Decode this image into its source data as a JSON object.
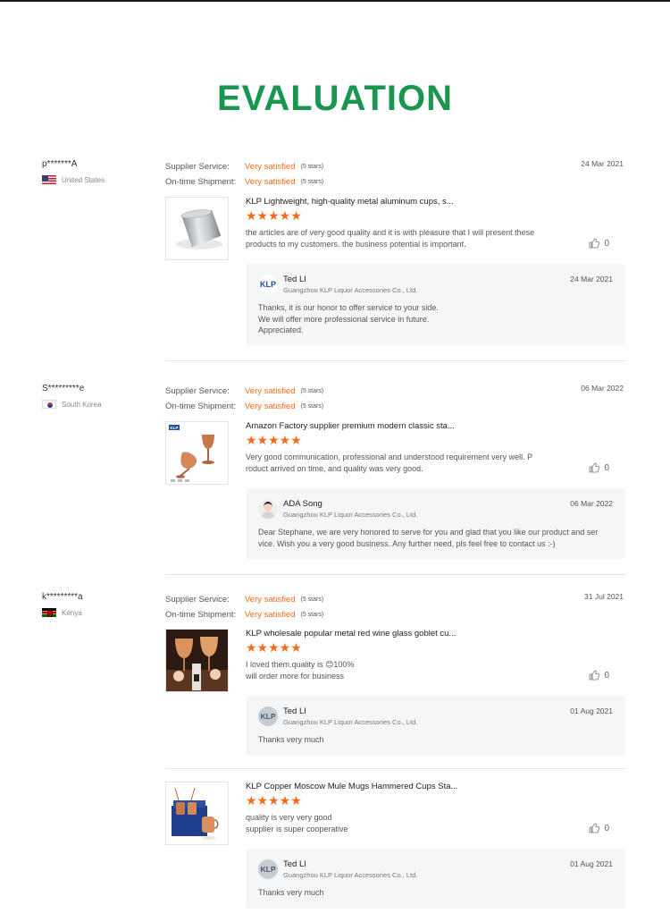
{
  "page": {
    "title": "EVALUATION"
  },
  "labels": {
    "supplier_service": "Supplier Service:",
    "ontime_shipment": "On-time Shipment:"
  },
  "colors": {
    "heading": "#1a9650",
    "accent": "#f26c1f"
  },
  "reviews": [
    {
      "user": "p*******A",
      "country": "United States",
      "flag": "us-flag",
      "supplier_service": "Very satisfied",
      "supplier_stars": "(5 stars)",
      "ontime_shipment": "Very satisfied",
      "ontime_stars": "(5 stars)",
      "date": "24 Mar 2021",
      "product_title": "KLP Lightweight, high-quality metal aluminum cups, s...",
      "product_image": "aluminum-cup-image",
      "rating": 5,
      "text_lines": [
        "the articles are of very good quality and it is with pleasure that I will present these",
        "products to my customers. the business potential is important."
      ],
      "likes": "0",
      "reply": {
        "name": "Ted LI",
        "company": "Guangzhou KLP Liquor Accessories Co., Ltd.",
        "date": "24 Mar 2021",
        "avatar_text": "KLP",
        "lines": [
          "Thanks, it is our honor to offer service to your side.",
          "We will offer more professional service in future.",
          "Appreciated."
        ]
      }
    },
    {
      "user": "S*********e",
      "country": "South Korea",
      "flag": "kr-flag",
      "supplier_service": "Very satisfied",
      "supplier_stars": "(5 stars)",
      "ontime_shipment": "Very satisfied",
      "ontime_stars": "(5 stars)",
      "date": "06 Mar 2022",
      "product_title": "Amazon Factory supplier premium modern classic sta...",
      "product_image": "copper-goblet-image",
      "product_image_logo": "KLP",
      "rating": 5,
      "text_lines": [
        "Very good communication, professional and understood requirement very  well. P",
        "roduct arrived on time, and quality was very good."
      ],
      "likes": "0",
      "reply": {
        "name": "ADA Song",
        "company": "Guangzhou KLP Liquor Accessories Co., Ltd.",
        "date": "06 Mar 2022",
        "avatar_text": "",
        "lines": [
          "Dear Stephane, we are very honored to serve for you and glad that you like our product and ser",
          "vice. Wish you a very good business. Any further need, pls feel free to contact us :-)"
        ]
      }
    },
    {
      "user": "k*********a",
      "country": "Kenya",
      "flag": "ke-flag",
      "supplier_service": "Very satisfied",
      "supplier_stars": "(5 stars)",
      "ontime_shipment": "Very satisfied",
      "ontime_stars": "(5 stars)",
      "date": "31 Jul 2021",
      "product_title": "KLP wholesale popular metal red wine glass goblet cu...",
      "product_image": "wine-goblet-photo",
      "rating": 5,
      "text_lines": [
        "I loved them.quality is 😊100%",
        "will order more for business"
      ],
      "likes": "0",
      "reply": {
        "name": "Ted LI",
        "company": "Guangzhou KLP Liquor Accessories Co., Ltd.",
        "date": "01 Aug 2021",
        "avatar_text": "KLP",
        "lines": [
          "Thanks very much"
        ]
      }
    },
    {
      "product_title": "KLP Copper Moscow Mule Mugs Hammered Cups Sta...",
      "product_image": "copper-mugs-gift-box-image",
      "rating": 5,
      "text_lines": [
        "quality is very very good",
        "supplier is super cooperative"
      ],
      "likes": "0",
      "reply": {
        "name": "Ted LI",
        "company": "Guangzhou KLP Liquor Accessories Co., Ltd.",
        "date": "01 Aug 2021",
        "avatar_text": "KLP",
        "lines": [
          "Thanks very much"
        ]
      }
    }
  ]
}
